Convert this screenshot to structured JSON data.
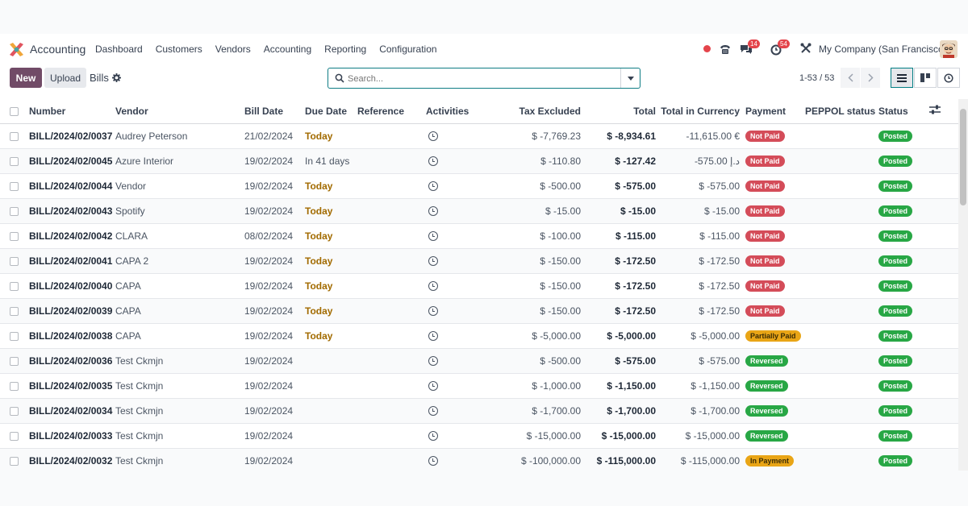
{
  "app": {
    "name": "Accounting"
  },
  "menu": [
    "Dashboard",
    "Customers",
    "Vendors",
    "Accounting",
    "Reporting",
    "Configuration"
  ],
  "systray": {
    "messages_count": "14",
    "activities_count": "54",
    "company": "My Company (San Francisco)"
  },
  "control": {
    "new_label": "New",
    "upload_label": "Upload",
    "breadcrumb": "Bills",
    "search_placeholder": "Search...",
    "pager": "1-53 / 53"
  },
  "columns": {
    "number": "Number",
    "vendor": "Vendor",
    "bill_date": "Bill Date",
    "due_date": "Due Date",
    "reference": "Reference",
    "activities": "Activities",
    "tax_excluded": "Tax Excluded",
    "total": "Total",
    "total_currency": "Total in Currency",
    "payment": "Payment",
    "peppol": "PEPPOL status",
    "status": "Status"
  },
  "colors": {
    "brand": "#714b67",
    "accent": "#017e84",
    "not_paid": "#d44c59",
    "partial": "#e9a516",
    "posted": "#28a745"
  },
  "rows": [
    {
      "number": "BILL/2024/02/0037",
      "vendor": "Audrey Peterson",
      "bill_date": "21/02/2024",
      "due_date": "Today",
      "due_today": true,
      "reference": "",
      "tax_excluded": "$ -7,769.23",
      "total": "$ -8,934.61",
      "total_currency": "-11,615.00 €",
      "payment": "Not Paid",
      "payment_kind": "notpaid",
      "peppol": "",
      "status": "Posted"
    },
    {
      "number": "BILL/2024/02/0045",
      "vendor": "Azure Interior",
      "bill_date": "19/02/2024",
      "due_date": "In 41 days",
      "due_today": false,
      "reference": "",
      "tax_excluded": "$ -110.80",
      "total": "$ -127.42",
      "total_currency": "-575.00 د.إ",
      "payment": "Not Paid",
      "payment_kind": "notpaid",
      "peppol": "",
      "status": "Posted"
    },
    {
      "number": "BILL/2024/02/0044",
      "vendor": "Vendor",
      "bill_date": "19/02/2024",
      "due_date": "Today",
      "due_today": true,
      "reference": "",
      "tax_excluded": "$ -500.00",
      "total": "$ -575.00",
      "total_currency": "$ -575.00",
      "payment": "Not Paid",
      "payment_kind": "notpaid",
      "peppol": "",
      "status": "Posted"
    },
    {
      "number": "BILL/2024/02/0043",
      "vendor": "Spotify",
      "bill_date": "19/02/2024",
      "due_date": "Today",
      "due_today": true,
      "reference": "",
      "tax_excluded": "$ -15.00",
      "total": "$ -15.00",
      "total_currency": "$ -15.00",
      "payment": "Not Paid",
      "payment_kind": "notpaid",
      "peppol": "",
      "status": "Posted"
    },
    {
      "number": "BILL/2024/02/0042",
      "vendor": "CLARA",
      "bill_date": "08/02/2024",
      "due_date": "Today",
      "due_today": true,
      "reference": "",
      "tax_excluded": "$ -100.00",
      "total": "$ -115.00",
      "total_currency": "$ -115.00",
      "payment": "Not Paid",
      "payment_kind": "notpaid",
      "peppol": "",
      "status": "Posted"
    },
    {
      "number": "BILL/2024/02/0041",
      "vendor": "CAPA 2",
      "bill_date": "19/02/2024",
      "due_date": "Today",
      "due_today": true,
      "reference": "",
      "tax_excluded": "$ -150.00",
      "total": "$ -172.50",
      "total_currency": "$ -172.50",
      "payment": "Not Paid",
      "payment_kind": "notpaid",
      "peppol": "",
      "status": "Posted"
    },
    {
      "number": "BILL/2024/02/0040",
      "vendor": "CAPA",
      "bill_date": "19/02/2024",
      "due_date": "Today",
      "due_today": true,
      "reference": "",
      "tax_excluded": "$ -150.00",
      "total": "$ -172.50",
      "total_currency": "$ -172.50",
      "payment": "Not Paid",
      "payment_kind": "notpaid",
      "peppol": "",
      "status": "Posted"
    },
    {
      "number": "BILL/2024/02/0039",
      "vendor": "CAPA",
      "bill_date": "19/02/2024",
      "due_date": "Today",
      "due_today": true,
      "reference": "",
      "tax_excluded": "$ -150.00",
      "total": "$ -172.50",
      "total_currency": "$ -172.50",
      "payment": "Not Paid",
      "payment_kind": "notpaid",
      "peppol": "",
      "status": "Posted"
    },
    {
      "number": "BILL/2024/02/0038",
      "vendor": "CAPA",
      "bill_date": "19/02/2024",
      "due_date": "Today",
      "due_today": true,
      "reference": "",
      "tax_excluded": "$ -5,000.00",
      "total": "$ -5,000.00",
      "total_currency": "$ -5,000.00",
      "payment": "Partially Paid",
      "payment_kind": "partial",
      "peppol": "",
      "status": "Posted"
    },
    {
      "number": "BILL/2024/02/0036",
      "vendor": "Test Ckmjn",
      "bill_date": "19/02/2024",
      "due_date": "",
      "due_today": false,
      "reference": "",
      "tax_excluded": "$ -500.00",
      "total": "$ -575.00",
      "total_currency": "$ -575.00",
      "payment": "Reversed",
      "payment_kind": "reversed",
      "peppol": "",
      "status": "Posted"
    },
    {
      "number": "BILL/2024/02/0035",
      "vendor": "Test Ckmjn",
      "bill_date": "19/02/2024",
      "due_date": "",
      "due_today": false,
      "reference": "",
      "tax_excluded": "$ -1,000.00",
      "total": "$ -1,150.00",
      "total_currency": "$ -1,150.00",
      "payment": "Reversed",
      "payment_kind": "reversed",
      "peppol": "",
      "status": "Posted"
    },
    {
      "number": "BILL/2024/02/0034",
      "vendor": "Test Ckmjn",
      "bill_date": "19/02/2024",
      "due_date": "",
      "due_today": false,
      "reference": "",
      "tax_excluded": "$ -1,700.00",
      "total": "$ -1,700.00",
      "total_currency": "$ -1,700.00",
      "payment": "Reversed",
      "payment_kind": "reversed",
      "peppol": "",
      "status": "Posted"
    },
    {
      "number": "BILL/2024/02/0033",
      "vendor": "Test Ckmjn",
      "bill_date": "19/02/2024",
      "due_date": "",
      "due_today": false,
      "reference": "",
      "tax_excluded": "$ -15,000.00",
      "total": "$ -15,000.00",
      "total_currency": "$ -15,000.00",
      "payment": "Reversed",
      "payment_kind": "reversed",
      "peppol": "",
      "status": "Posted"
    },
    {
      "number": "BILL/2024/02/0032",
      "vendor": "Test Ckmjn",
      "bill_date": "19/02/2024",
      "due_date": "",
      "due_today": false,
      "reference": "",
      "tax_excluded": "$ -100,000.00",
      "total": "$ -115,000.00",
      "total_currency": "$ -115,000.00",
      "payment": "In Payment",
      "payment_kind": "inpayment",
      "peppol": "",
      "status": "Posted"
    }
  ]
}
